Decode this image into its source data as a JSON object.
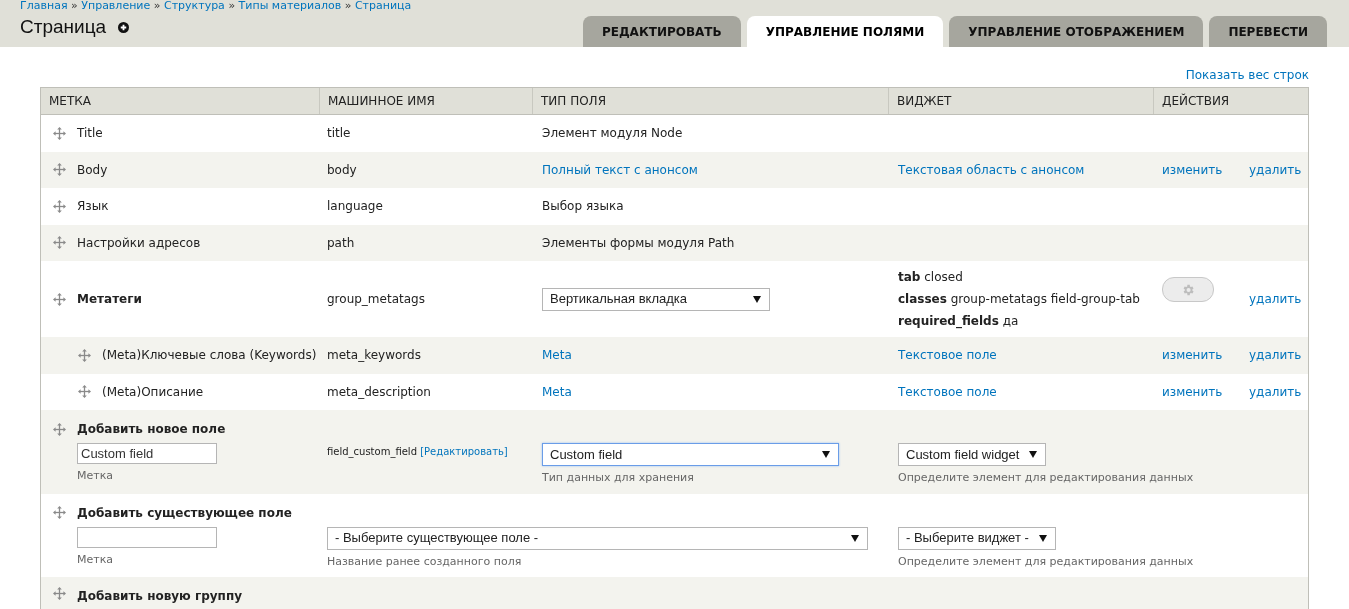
{
  "breadcrumb": [
    "Главная",
    "Управление",
    "Структура",
    "Типы материалов",
    "Страница"
  ],
  "breadcrumb_separator": "»",
  "title": "Страница",
  "tabs": [
    {
      "label": "РЕДАКТИРОВАТЬ",
      "selected": false
    },
    {
      "label": "УПРАВЛЕНИЕ ПОЛЯМИ",
      "selected": true
    },
    {
      "label": "УПРАВЛЕНИЕ ОТОБРАЖЕНИЕМ",
      "selected": false
    },
    {
      "label": "ПЕРЕВЕСТИ",
      "selected": false
    }
  ],
  "show_weights_link": "Показать вес строк",
  "table": {
    "columns": [
      "МЕТКА",
      "МАШИННОЕ ИМЯ",
      "ТИП ПОЛЯ",
      "ВИДЖЕТ",
      "ДЕЙСТВИЯ"
    ],
    "rows": [
      {
        "kind": "field",
        "label": "Title",
        "machine_name": "title",
        "field_type": {
          "text": "Элемент модуля Node",
          "link": false
        }
      },
      {
        "kind": "field",
        "label": "Body",
        "machine_name": "body",
        "field_type": {
          "text": "Полный текст с анонсом",
          "link": true
        },
        "widget": {
          "text": "Текстовая область с анонсом",
          "link": true
        },
        "edit": "изменить",
        "delete": "удалить"
      },
      {
        "kind": "field",
        "label": "Язык",
        "machine_name": "language",
        "field_type": {
          "text": "Выбор языка",
          "link": false
        }
      },
      {
        "kind": "field",
        "label": "Настройки адресов",
        "machine_name": "path",
        "field_type": {
          "text": "Элементы формы модуля Path",
          "link": false
        }
      },
      {
        "kind": "group",
        "label": "Метатеги",
        "machine_name": "group_metatags",
        "select": "Вертикальная вкладка",
        "settings": [
          {
            "key": "tab",
            "value": "closed"
          },
          {
            "key": "classes",
            "value": "group-metatags field-group-tab"
          },
          {
            "key": "required_fields",
            "value": "да"
          }
        ],
        "delete": "удалить",
        "children": [
          {
            "kind": "field",
            "label": "(Meta)Ключевые слова (Keywords)",
            "machine_name": "meta_keywords",
            "field_type": {
              "text": "Meta",
              "link": true
            },
            "widget": {
              "text": "Текстовое поле",
              "link": true
            },
            "edit": "изменить",
            "delete": "удалить"
          },
          {
            "kind": "field",
            "label": "(Meta)Описание",
            "machine_name": "meta_description",
            "field_type": {
              "text": "Meta",
              "link": true
            },
            "widget": {
              "text": "Текстовое поле",
              "link": true
            },
            "edit": "изменить",
            "delete": "удалить"
          }
        ]
      },
      {
        "kind": "add_new",
        "title": "Добавить новое поле",
        "label_value": "Custom field",
        "label_hint": "Метка",
        "machine_name": "field_custom_field",
        "machine_name_edit": "[Редактировать]",
        "type_select": "Custom field",
        "type_select_focused": true,
        "type_hint": "Тип данных для хранения",
        "widget_select": "Custom field widget",
        "widget_hint": "Определите элемент для редактирования данных"
      },
      {
        "kind": "add_existing",
        "title": "Добавить существующее поле",
        "label_hint": "Метка",
        "field_select": "- Выберите существующее поле -",
        "field_hint": "Название ранее созданного поля",
        "widget_select": "- Выберите виджет -",
        "widget_hint": "Определите элемент для редактирования данных"
      },
      {
        "kind": "add_group",
        "title": "Добавить новую группу"
      }
    ]
  }
}
